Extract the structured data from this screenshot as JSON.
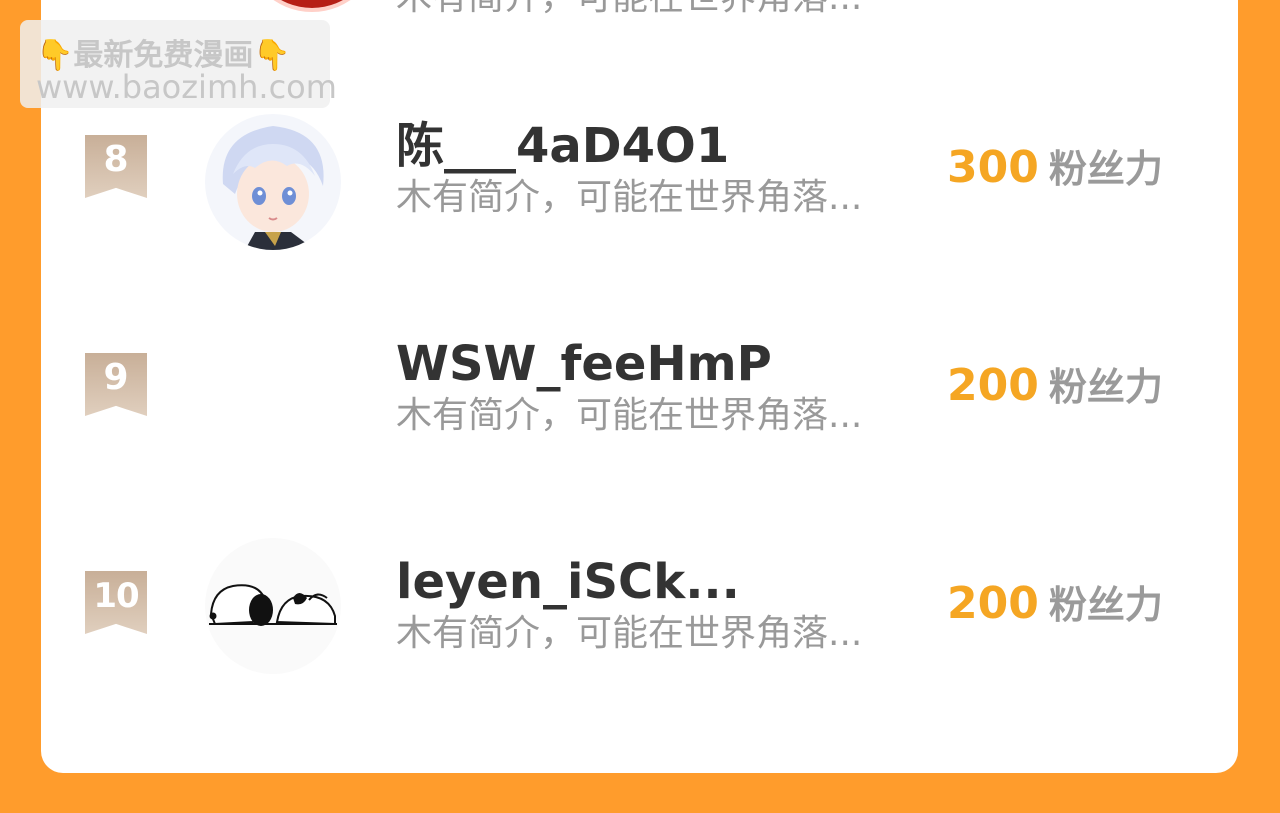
{
  "watermark": {
    "line1_icon_left": "👇",
    "line1_text": "最新免费漫画",
    "line1_icon_right": "👇",
    "line2_text": "www.baozimh.com"
  },
  "partial_row": {
    "desc": "木有简介，可能在世界角落..."
  },
  "ranking": [
    {
      "rank": "8",
      "name": "陈___4aD4O1",
      "desc": "木有简介，可能在世界角落...",
      "fans": "300",
      "fans_unit": "粉丝力",
      "avatar": "anime-boy-avatar"
    },
    {
      "rank": "9",
      "name": "WSW_feeHmP",
      "desc": "木有简介，可能在世界角落...",
      "fans": "200",
      "fans_unit": "粉丝力",
      "avatar": "none"
    },
    {
      "rank": "10",
      "name": "leyen_iSCk...",
      "desc": "木有简介，可能在世界角落...",
      "fans": "200",
      "fans_unit": "粉丝力",
      "avatar": "snoopy-avatar"
    }
  ],
  "colors": {
    "background": "#FF9C2C",
    "card": "#FFFFFF",
    "fans_number": "#F5A623",
    "badge": "#C8AF98"
  }
}
